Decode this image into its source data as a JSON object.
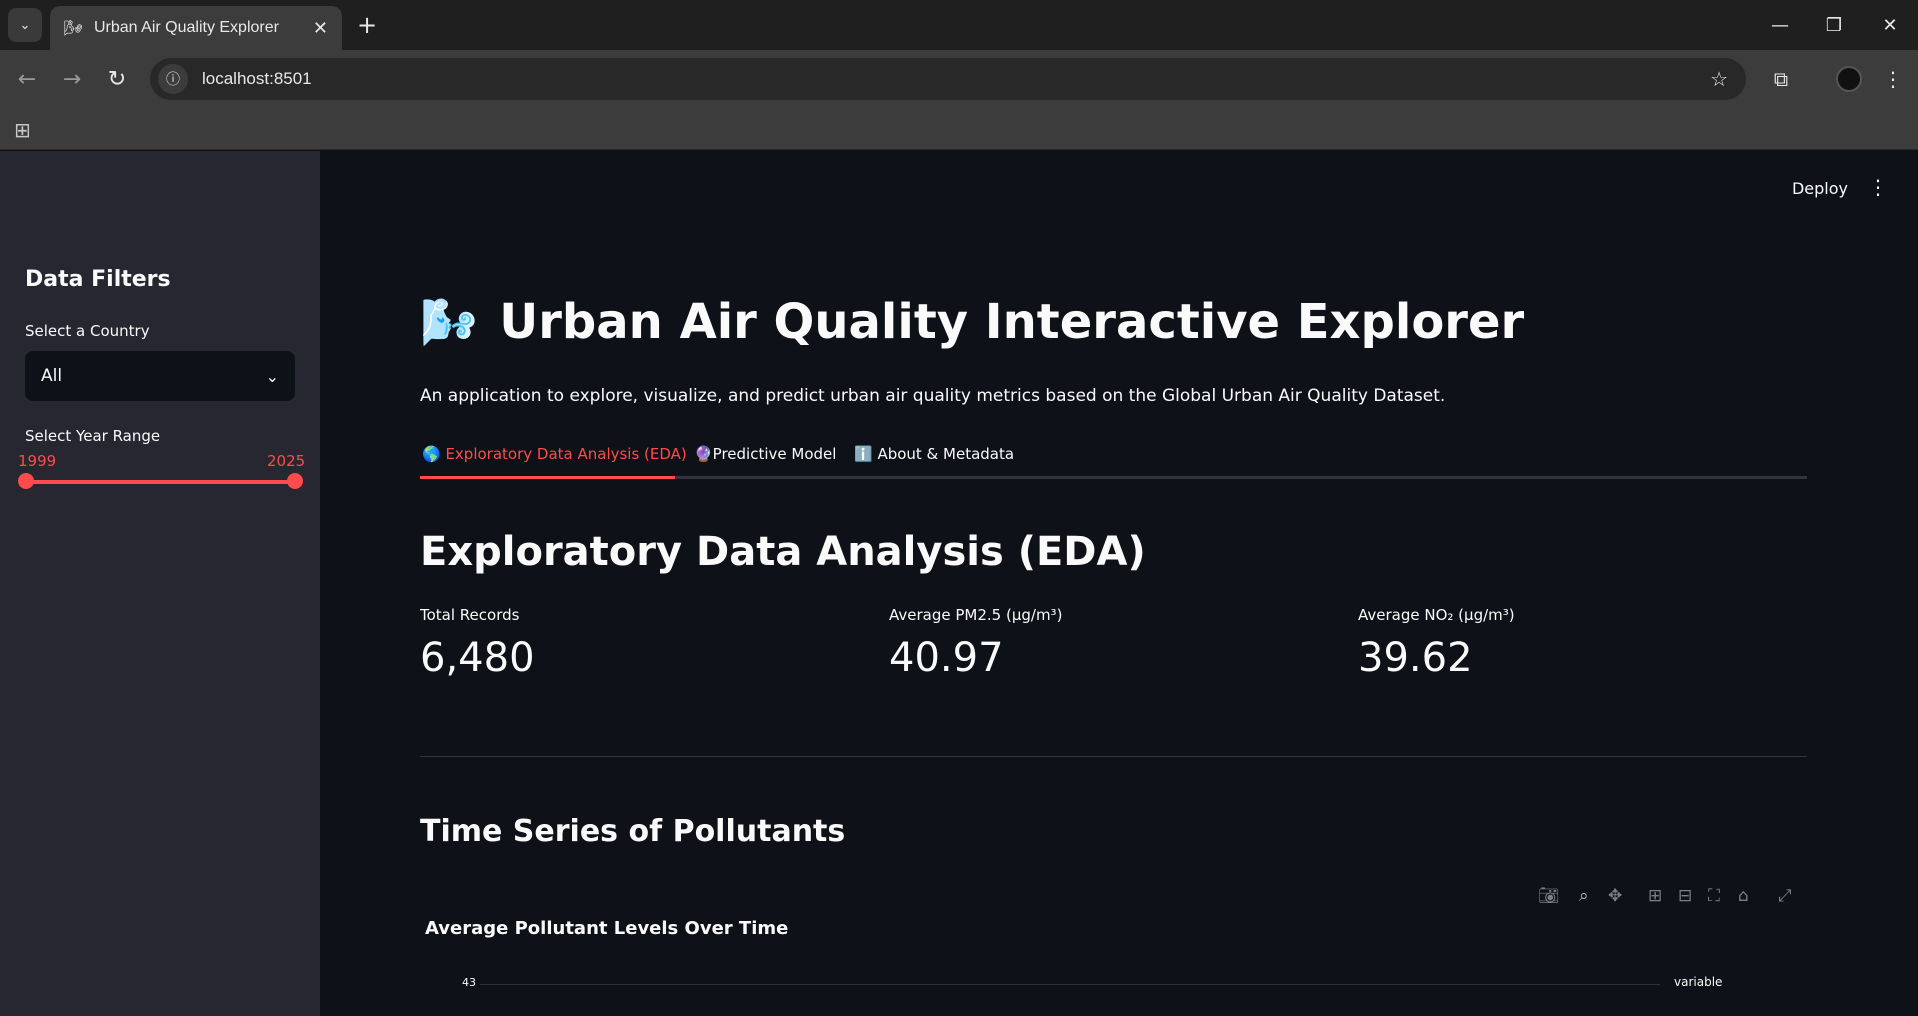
{
  "browser": {
    "tab_title": "Urban Air Quality Explorer",
    "url": "localhost:8501"
  },
  "header": {
    "deploy_label": "Deploy"
  },
  "sidebar": {
    "title": "Data Filters",
    "country_label": "Select a Country",
    "country_value": "All",
    "year_label": "Select Year Range",
    "year_min": "1999",
    "year_max": "2025"
  },
  "main": {
    "title_emoji": "🌬️",
    "title": "Urban Air Quality Interactive Explorer",
    "description": "An application to explore, visualize, and predict urban air quality metrics based on the Global Urban Air Quality Dataset.",
    "tabs": [
      {
        "label": "🌎 Exploratory Data Analysis (EDA)"
      },
      {
        "label": "🔮Predictive Model"
      },
      {
        "label": "ℹ️ About & Metadata"
      }
    ],
    "section_title": "Exploratory Data Analysis (EDA)",
    "metrics": [
      {
        "label": "Total Records",
        "value": "6,480"
      },
      {
        "label": "Average PM2.5 (µg/m³)",
        "value": "40.97"
      },
      {
        "label": "Average NO₂ (µg/m³)",
        "value": "39.62"
      }
    ],
    "subsection_title": "Time Series of Pollutants",
    "chart": {
      "title": "Average Pollutant Levels Over Time",
      "first_ytick": "43",
      "legend_title": "variable"
    }
  },
  "colors": {
    "accent": "#ff4b4b",
    "background": "#0e1117",
    "sidebar": "#262730"
  }
}
